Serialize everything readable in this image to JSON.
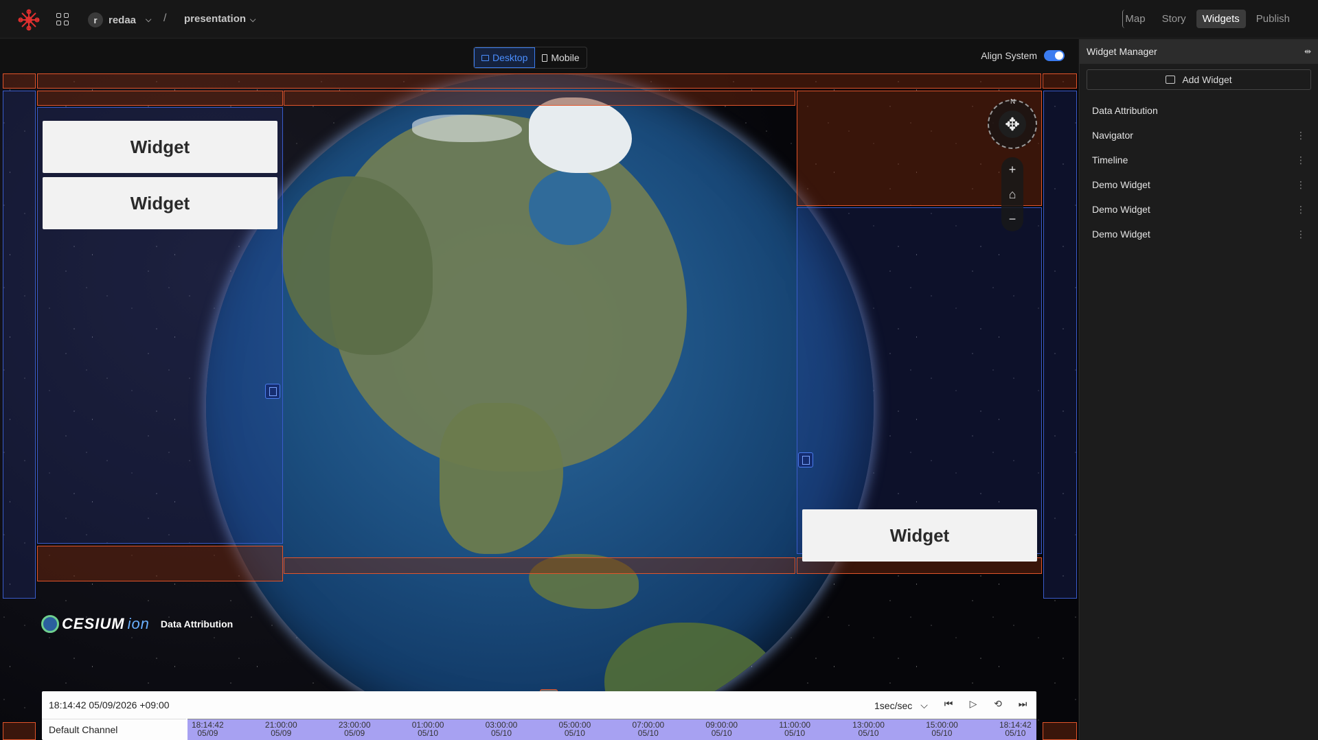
{
  "header": {
    "workspace_initial": "r",
    "workspace": "redaa",
    "separator": "/",
    "project": "presentation",
    "nav": [
      {
        "label": "Map"
      },
      {
        "label": "Story"
      },
      {
        "label": "Widgets",
        "active": true
      },
      {
        "label": "Publish"
      }
    ]
  },
  "devices": {
    "desktop": "Desktop",
    "mobile": "Mobile",
    "selected": "Desktop"
  },
  "align_system": {
    "label": "Align System",
    "enabled": true
  },
  "widgets": {
    "left_1": "Widget",
    "left_2": "Widget",
    "right_1": "Widget"
  },
  "navigator": {
    "north": "N",
    "zoom_in": "+",
    "zoom_out": "−",
    "home_icon": "home-icon"
  },
  "attribution": {
    "logo_text": "CESIUM",
    "logo_suffix": "ion",
    "label": "Data Attribution"
  },
  "timeline": {
    "current_time": "18:14:42 05/09/2026 +09:00",
    "speed": "1sec/sec",
    "channel": "Default Channel",
    "ticks": [
      {
        "time": "18:14:42",
        "date": "05/09"
      },
      {
        "time": "21:00:00",
        "date": "05/09"
      },
      {
        "time": "23:00:00",
        "date": "05/09"
      },
      {
        "time": "01:00:00",
        "date": "05/10"
      },
      {
        "time": "03:00:00",
        "date": "05/10"
      },
      {
        "time": "05:00:00",
        "date": "05/10"
      },
      {
        "time": "07:00:00",
        "date": "05/10"
      },
      {
        "time": "09:00:00",
        "date": "05/10"
      },
      {
        "time": "11:00:00",
        "date": "05/10"
      },
      {
        "time": "13:00:00",
        "date": "05/10"
      },
      {
        "time": "15:00:00",
        "date": "05/10"
      },
      {
        "time": "18:14:42",
        "date": "05/10"
      }
    ]
  },
  "panel": {
    "title": "Widget Manager",
    "add_label": "Add Widget",
    "items": [
      {
        "label": "Data Attribution"
      },
      {
        "label": "Navigator"
      },
      {
        "label": "Timeline"
      },
      {
        "label": "Demo Widget"
      },
      {
        "label": "Demo Widget"
      },
      {
        "label": "Demo Widget"
      }
    ]
  },
  "colors": {
    "accent": "#3b7cf0",
    "zone_border": "#e2542a",
    "active_tab_bg": "#3b3b3b"
  }
}
